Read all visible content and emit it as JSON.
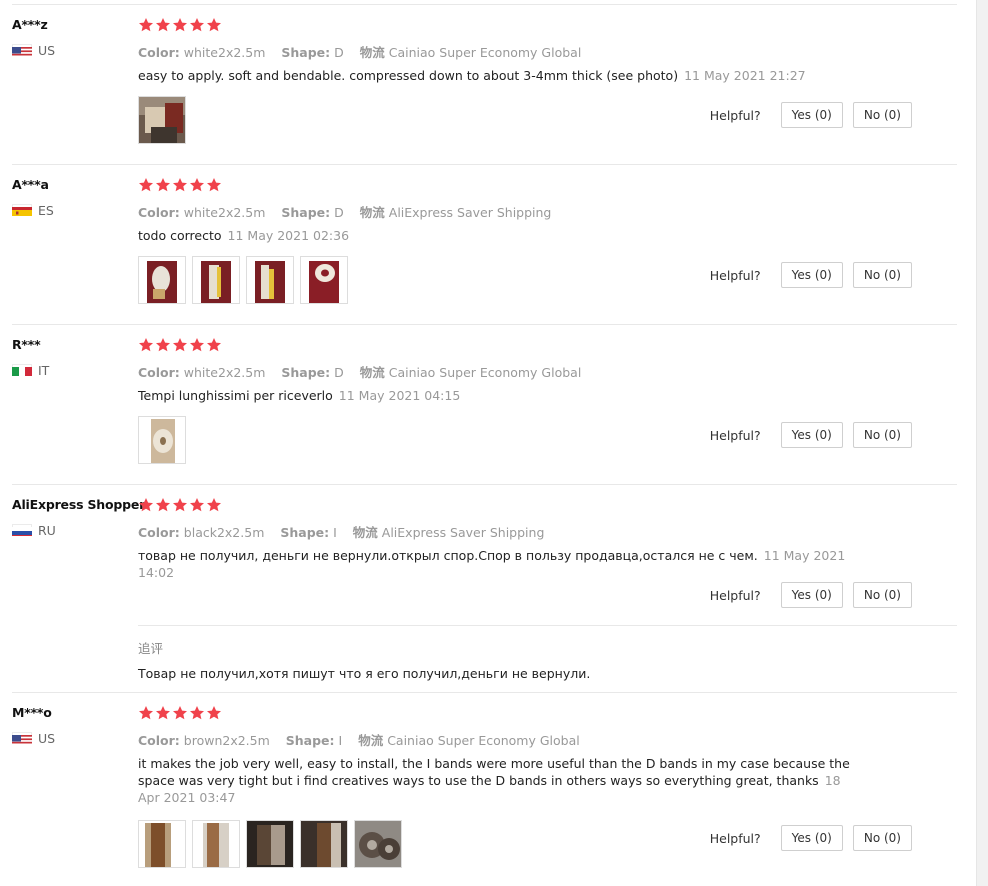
{
  "labels": {
    "color": "Color:",
    "shape": "Shape:",
    "logistics": "物流",
    "helpful": "Helpful?"
  },
  "reviews": [
    {
      "user": "A***z",
      "country": "US",
      "flag": "us",
      "stars": 5,
      "color": "white2x2.5m",
      "shape": "D",
      "logistics": "Cainiao Super Economy Global",
      "text": "easy to apply. soft and bendable. compressed down to about 3-4mm thick (see photo)",
      "date": "11 May 2021 21:27",
      "yes": "Yes (0)",
      "no": "No (0)"
    },
    {
      "user": "A***a",
      "country": "ES",
      "flag": "es",
      "stars": 5,
      "color": "white2x2.5m",
      "shape": "D",
      "logistics": "AliExpress Saver Shipping",
      "text": "todo correcto",
      "date": "11 May 2021 02:36",
      "yes": "Yes (0)",
      "no": "No (0)"
    },
    {
      "user": "R***",
      "country": "IT",
      "flag": "it",
      "stars": 5,
      "color": "white2x2.5m",
      "shape": "D",
      "logistics": "Cainiao Super Economy Global",
      "text": "Tempi lunghissimi per riceverlo",
      "date": "11 May 2021 04:15",
      "yes": "Yes (0)",
      "no": "No (0)"
    },
    {
      "user": "AliExpress Shopper",
      "country": "RU",
      "flag": "ru",
      "stars": 5,
      "color": "black2x2.5m",
      "shape": "I",
      "logistics": "AliExpress Saver Shipping",
      "text": "товар не получил, деньги не вернули.открыл спор.Спор в пользу продавца,остался не с чем.",
      "date": "11 May 2021 14:02",
      "yes": "Yes (0)",
      "no": "No (0)",
      "followup": {
        "title": "追评",
        "text": "Товар не получил,хотя пишут что я его получил,деньги не вернули."
      }
    },
    {
      "user": "M***o",
      "country": "US",
      "flag": "us",
      "stars": 5,
      "color": "brown2x2.5m",
      "shape": "I",
      "logistics": "Cainiao Super Economy Global",
      "text": "it makes the job very well, easy to install, the I bands were more useful than the D bands in my case because the space was very tight but i find creatives ways to use the D bands in others ways so everything great, thanks",
      "date": "18 Apr 2021 03:47",
      "yes": "Yes (0)",
      "no": "No (0)"
    }
  ]
}
